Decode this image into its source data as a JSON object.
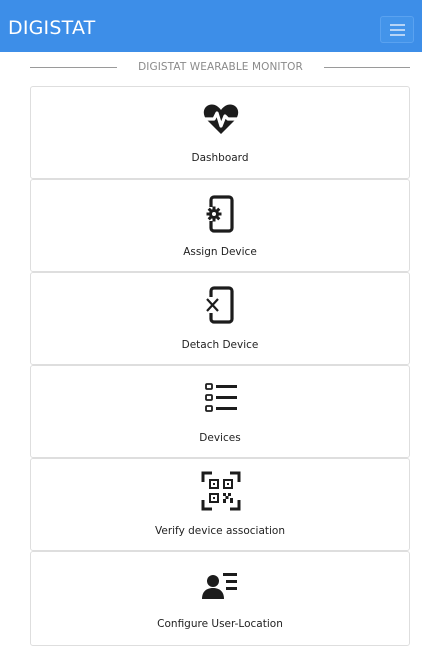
{
  "navbar": {
    "brand": "DIGISTAT",
    "menu_icon": "hamburger-menu-icon",
    "color": "#3d8ee8"
  },
  "section": {
    "title": "DIGISTAT WEARABLE MONITOR"
  },
  "tiles": [
    {
      "label": "Dashboard",
      "icon": "heart-pulse-icon"
    },
    {
      "label": "Assign Device",
      "icon": "mobile-gear-icon"
    },
    {
      "label": "Detach Device",
      "icon": "mobile-x-icon"
    },
    {
      "label": "Devices",
      "icon": "list-icon"
    },
    {
      "label": "Verify device association",
      "icon": "qr-code-scan-icon"
    },
    {
      "label": "Configure User-Location",
      "icon": "user-list-icon"
    }
  ]
}
